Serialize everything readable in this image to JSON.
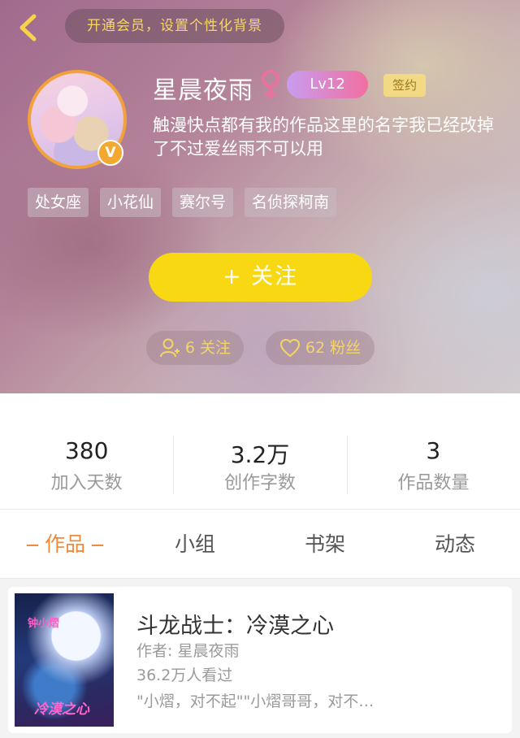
{
  "header": {
    "back_icon": "chevron-left-icon",
    "vip_promo": "开通会员，设置个性化背景"
  },
  "profile": {
    "username": "星晨夜雨",
    "gender": "female",
    "gender_icon": "female-symbol-icon",
    "level": "Lv12",
    "signed_badge": "签约",
    "verified_badge": "V",
    "bio": "触漫快点都有我的作品这里的名字我已经改掉了不过爱丝雨不可以用",
    "tags": [
      "处女座",
      "小花仙",
      "赛尔号",
      "名侦探柯南"
    ],
    "follow_button": "+  关注",
    "following_label": "6 关注",
    "fans_label": "62 粉丝"
  },
  "stats": [
    {
      "value": "380",
      "label": "加入天数"
    },
    {
      "value": "3.2万",
      "label": "创作字数"
    },
    {
      "value": "3",
      "label": "作品数量"
    }
  ],
  "tabs": [
    {
      "label": "作品",
      "active": true
    },
    {
      "label": "小组",
      "active": false
    },
    {
      "label": "书架",
      "active": false
    },
    {
      "label": "动态",
      "active": false
    }
  ],
  "works": [
    {
      "title": "斗龙战士：冷漠之心",
      "author": "作者: 星晨夜雨",
      "views": "36.2万人看过",
      "excerpt": "\"小熠，对不起\"\"小熠哥哥，对不…",
      "cover_text_top": "钟小熠",
      "cover_text_bottom": "冷漠之心"
    }
  ],
  "colors": {
    "accent_orange": "#f08a3c",
    "follow_yellow": "#f8d813",
    "gold_text": "#f4d565",
    "level_gradient_start": "#c99cf0",
    "level_gradient_end": "#f06fa0"
  }
}
